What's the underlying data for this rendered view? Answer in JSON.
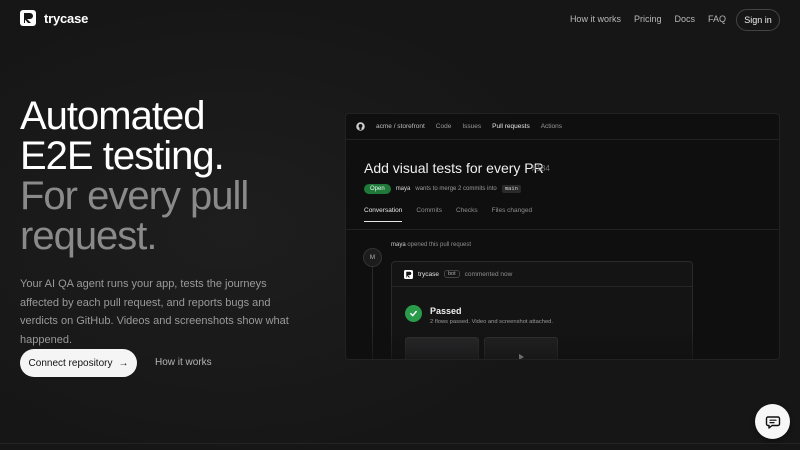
{
  "brand": {
    "name": "trycase",
    "icon": "trycase-logo-icon"
  },
  "nav": {
    "links": [
      "How it works",
      "Pricing",
      "Docs",
      "FAQ"
    ],
    "signin_label": "Sign in"
  },
  "hero": {
    "title_line1": "Automated",
    "title_line2": "E2E testing.",
    "title_line3": "For every pull",
    "title_line4": "request.",
    "subtitle": "Your AI QA agent runs your app, tests the journeys affected by each pull request, and reports bugs and verdicts on GitHub. Videos and screenshots show what happened.",
    "primary_cta": "Connect repository",
    "primary_cta_arrow": "→",
    "secondary_cta": "How it works"
  },
  "mock": {
    "repo": "acme / storefront",
    "nav_items": [
      "Code",
      "Issues",
      "Pull requests",
      "Actions"
    ],
    "active_nav": "Pull requests",
    "pr_title": "Add visual tests for every PR",
    "pr_number": "#184",
    "status_badge": "Open",
    "author": "maya",
    "meta_text": "wants to merge 2 commits into",
    "branch": "main",
    "tabs": [
      "Conversation",
      "Commits",
      "Checks",
      "Files changed"
    ],
    "active_tab": "Conversation",
    "timeline_avatar": "M",
    "opened_user": "maya",
    "opened_text": "opened this pull request",
    "comment": {
      "bot_name": "trycase",
      "bot_badge": "bot",
      "time": "commented now",
      "result_title": "Passed",
      "result_sub": "2 flows passed. Video and screenshot attached."
    }
  },
  "icons": {
    "github": "github-icon",
    "check": "check-icon",
    "play": "play-icon",
    "chat": "chat-bubble-icon"
  },
  "colors": {
    "background": "#161616",
    "accent_green": "#2a9a4b",
    "badge_green": "#1f7a3a",
    "primary_button": "#f5f5f5"
  }
}
